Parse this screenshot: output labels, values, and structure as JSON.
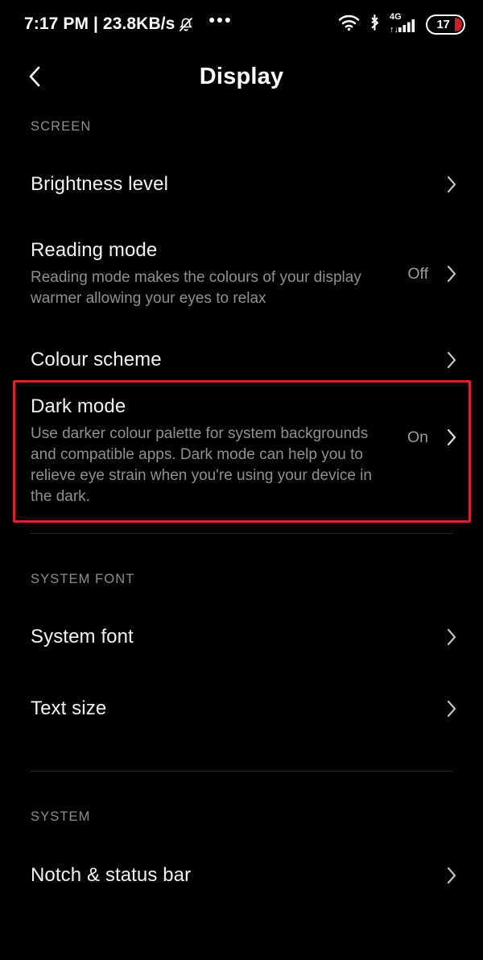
{
  "statusbar": {
    "clock": "7:17 PM | 23.8KB/s",
    "mute_icon": "bell-muted-icon",
    "overflow": "•••",
    "wifi_icon": "wifi-icon",
    "bluetooth_icon": "bluetooth-icon",
    "network_label": "4G",
    "signal_icon": "signal-bars-icon",
    "battery_level": "17"
  },
  "header": {
    "back_icon": "chevron-left-icon",
    "title": "Display"
  },
  "sections": [
    {
      "label": "SCREEN",
      "rows": [
        {
          "title": "Brightness level",
          "sub": "",
          "value": "",
          "chevron": "chevron-right-icon"
        },
        {
          "title": "Reading mode",
          "sub": "Reading mode makes the colours of your display warmer allowing your eyes to relax",
          "value": "Off",
          "chevron": "chevron-right-icon"
        },
        {
          "title": "Colour scheme",
          "sub": "",
          "value": "",
          "chevron": "chevron-right-icon"
        },
        {
          "title": "Dark mode",
          "sub": "Use darker colour palette for system backgrounds and compatible apps. Dark mode can help you to relieve eye strain when you're using your device in the dark.",
          "value": "On",
          "chevron": "chevron-right-icon",
          "highlighted": true
        }
      ]
    },
    {
      "label": "SYSTEM FONT",
      "rows": [
        {
          "title": "System font",
          "sub": "",
          "value": "",
          "chevron": "chevron-right-icon"
        },
        {
          "title": "Text size",
          "sub": "",
          "value": "",
          "chevron": "chevron-right-icon"
        }
      ]
    },
    {
      "label": "SYSTEM",
      "rows": [
        {
          "title": "Notch & status bar",
          "sub": "",
          "value": "",
          "chevron": "chevron-right-icon"
        }
      ]
    }
  ],
  "colors": {
    "background": "#000000",
    "highlight": "#e01f31",
    "primary_text": "#f2f2f2",
    "secondary_text": "#8f8f8f",
    "battery_accent": "#d31b24"
  }
}
